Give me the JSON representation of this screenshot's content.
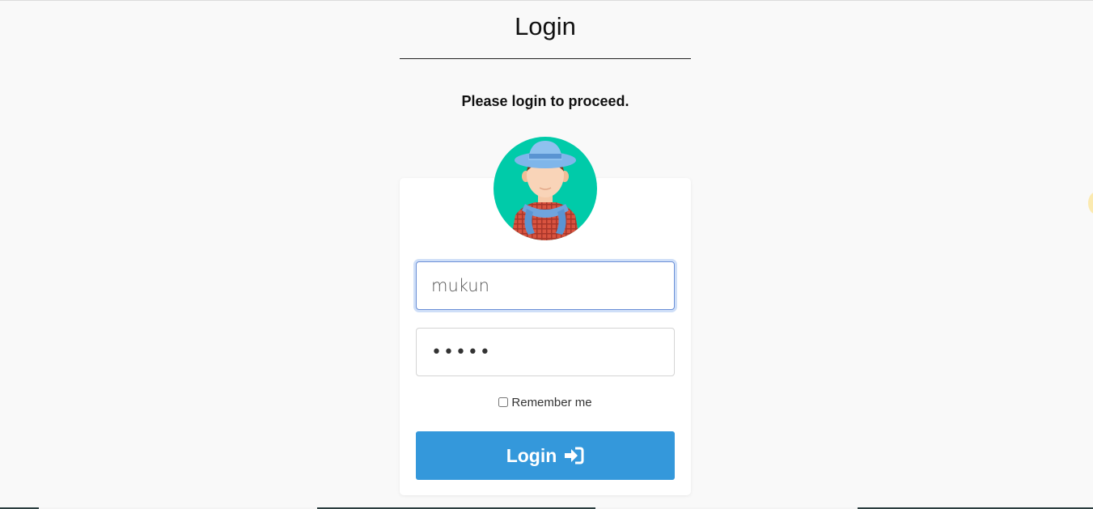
{
  "page": {
    "title": "Login",
    "subtitle": "Please login to proceed."
  },
  "form": {
    "username": {
      "value": "mukun",
      "placeholder": ""
    },
    "password": {
      "value": "•••••",
      "placeholder": ""
    },
    "remember_label": "Remember me",
    "remember_checked": false,
    "login_button_label": "Login",
    "login_button_icon": "sign-in-icon"
  },
  "colors": {
    "accent": "#3498db",
    "focus_border": "#6b8fd6",
    "avatar_bg": "#00cba9",
    "background": "#f9f9f9"
  }
}
